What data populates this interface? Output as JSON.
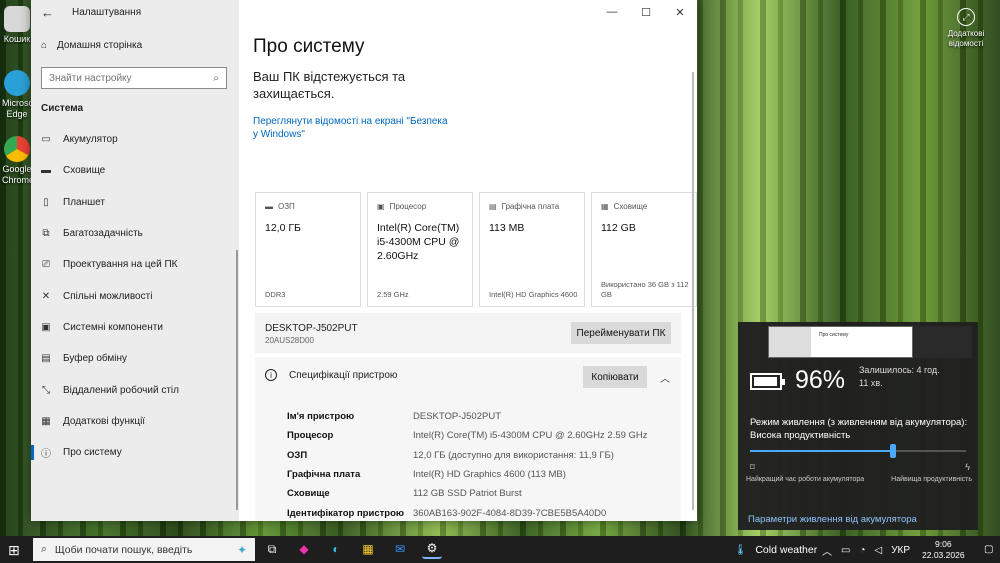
{
  "desktop": {
    "icons": [
      {
        "label": "Кошик",
        "color": "#d8d8d8"
      },
      {
        "label": "Microsoft Edge",
        "color": "#2aa0d8"
      },
      {
        "label": "Google Chrome",
        "color": "#e94235"
      }
    ],
    "additional": "Додаткові відомості"
  },
  "window": {
    "title": "Налаштування",
    "controls": {
      "minimize": "—",
      "maximize": "☐",
      "close": "✕"
    }
  },
  "sidebar": {
    "home": "Домашня сторінка",
    "search_placeholder": "Знайти настройку",
    "section": "Система",
    "items": [
      {
        "label": "Акумулятор",
        "icon": "▭"
      },
      {
        "label": "Сховище",
        "icon": "▬"
      },
      {
        "label": "Планшет",
        "icon": "▯"
      },
      {
        "label": "Багатозадачність",
        "icon": "⧉"
      },
      {
        "label": "Проектування на цей ПК",
        "icon": "⎚"
      },
      {
        "label": "Спільні можливості",
        "icon": "✕"
      },
      {
        "label": "Системні компоненти",
        "icon": "▣"
      },
      {
        "label": "Буфер обміну",
        "icon": "▤"
      },
      {
        "label": "Віддалений робочий стіл",
        "icon": "⤡"
      },
      {
        "label": "Додаткові функції",
        "icon": "▦"
      },
      {
        "label": "Про систему",
        "icon": "ⓘ"
      }
    ]
  },
  "main": {
    "title": "Про систему",
    "status": "Ваш ПК відстежується та захищається.",
    "link": "Переглянути відомості на екрані \"Безпека у Windows\"",
    "cards": [
      {
        "label": "ОЗП",
        "value": "12,0 ГБ",
        "sub": "DDR3"
      },
      {
        "label": "Процесор",
        "value": "Intel(R) Core(TM) i5-4300M CPU @ 2.60GHz",
        "sub": "2.59 GHz"
      },
      {
        "label": "Графічна плата",
        "value": "113 MB",
        "sub": "Intel(R) HD Graphics 4600"
      },
      {
        "label": "Сховище",
        "value": "112 GB",
        "sub": "Використано 36 GB з 112 GB"
      }
    ],
    "pc_name": "DESKTOP-J502PUT",
    "pc_id": "20AUS28D00",
    "rename_button": "Перейменувати ПК",
    "spec_title": "Специфікації пристрою",
    "copy_button": "Копіювати",
    "specs": [
      {
        "key": "Ім'я пристрою",
        "value": "DESKTOP-J502PUT"
      },
      {
        "key": "Процесор",
        "value": "Intel(R) Core(TM) i5-4300M CPU @ 2.60GHz   2.59 GHz"
      },
      {
        "key": "ОЗП",
        "value": "12,0 ГБ (доступно для використання: 11,9 ГБ)"
      },
      {
        "key": "Графічна плата",
        "value": "Intel(R) HD Graphics 4600 (113 MB)"
      },
      {
        "key": "Сховище",
        "value": "112 GB SSD Patriot Burst"
      },
      {
        "key": "Ідентифікатор пристрою",
        "value": "360AB163-902F-4084-8D39-7CBE5B5A40D0"
      }
    ]
  },
  "battery": {
    "percent": "96%",
    "percent_value": 0.96,
    "remaining_line1": "Залишилось: 4 год.",
    "remaining_line2": "11 хв.",
    "mode_line1": "Режим живлення (з живленням від акумулятора):",
    "mode_line2": "Висока продуктивність",
    "slider_value": 0.66,
    "left_label": "Найкращий час роботи акумулятора",
    "right_label": "Найвища продуктивність",
    "settings_link": "Параметри живлення від акумулятора"
  },
  "taskbar": {
    "search_placeholder": "Щоби почати пошук, введіть",
    "weather": "Cold weather",
    "lang": "УКР",
    "time": "9:06",
    "date": "22.03.2026"
  }
}
